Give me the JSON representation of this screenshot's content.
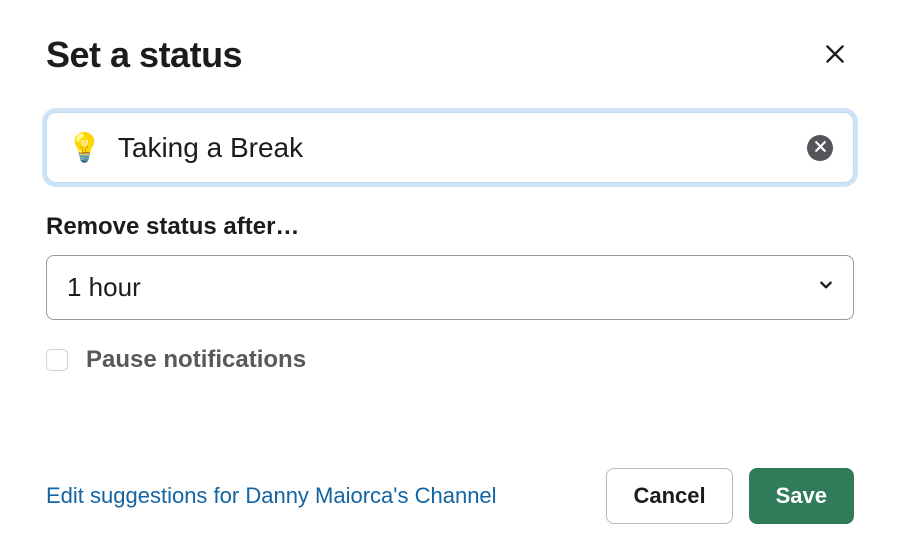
{
  "modal": {
    "title": "Set a status",
    "status": {
      "emoji": "💡",
      "value": "Taking a Break"
    },
    "remove_after": {
      "label": "Remove status after…",
      "selected": "1 hour"
    },
    "pause_notifications": {
      "label": "Pause notifications",
      "checked": false
    },
    "footer": {
      "edit_link": "Edit suggestions for Danny Maiorca's Channel",
      "cancel": "Cancel",
      "save": "Save"
    }
  }
}
